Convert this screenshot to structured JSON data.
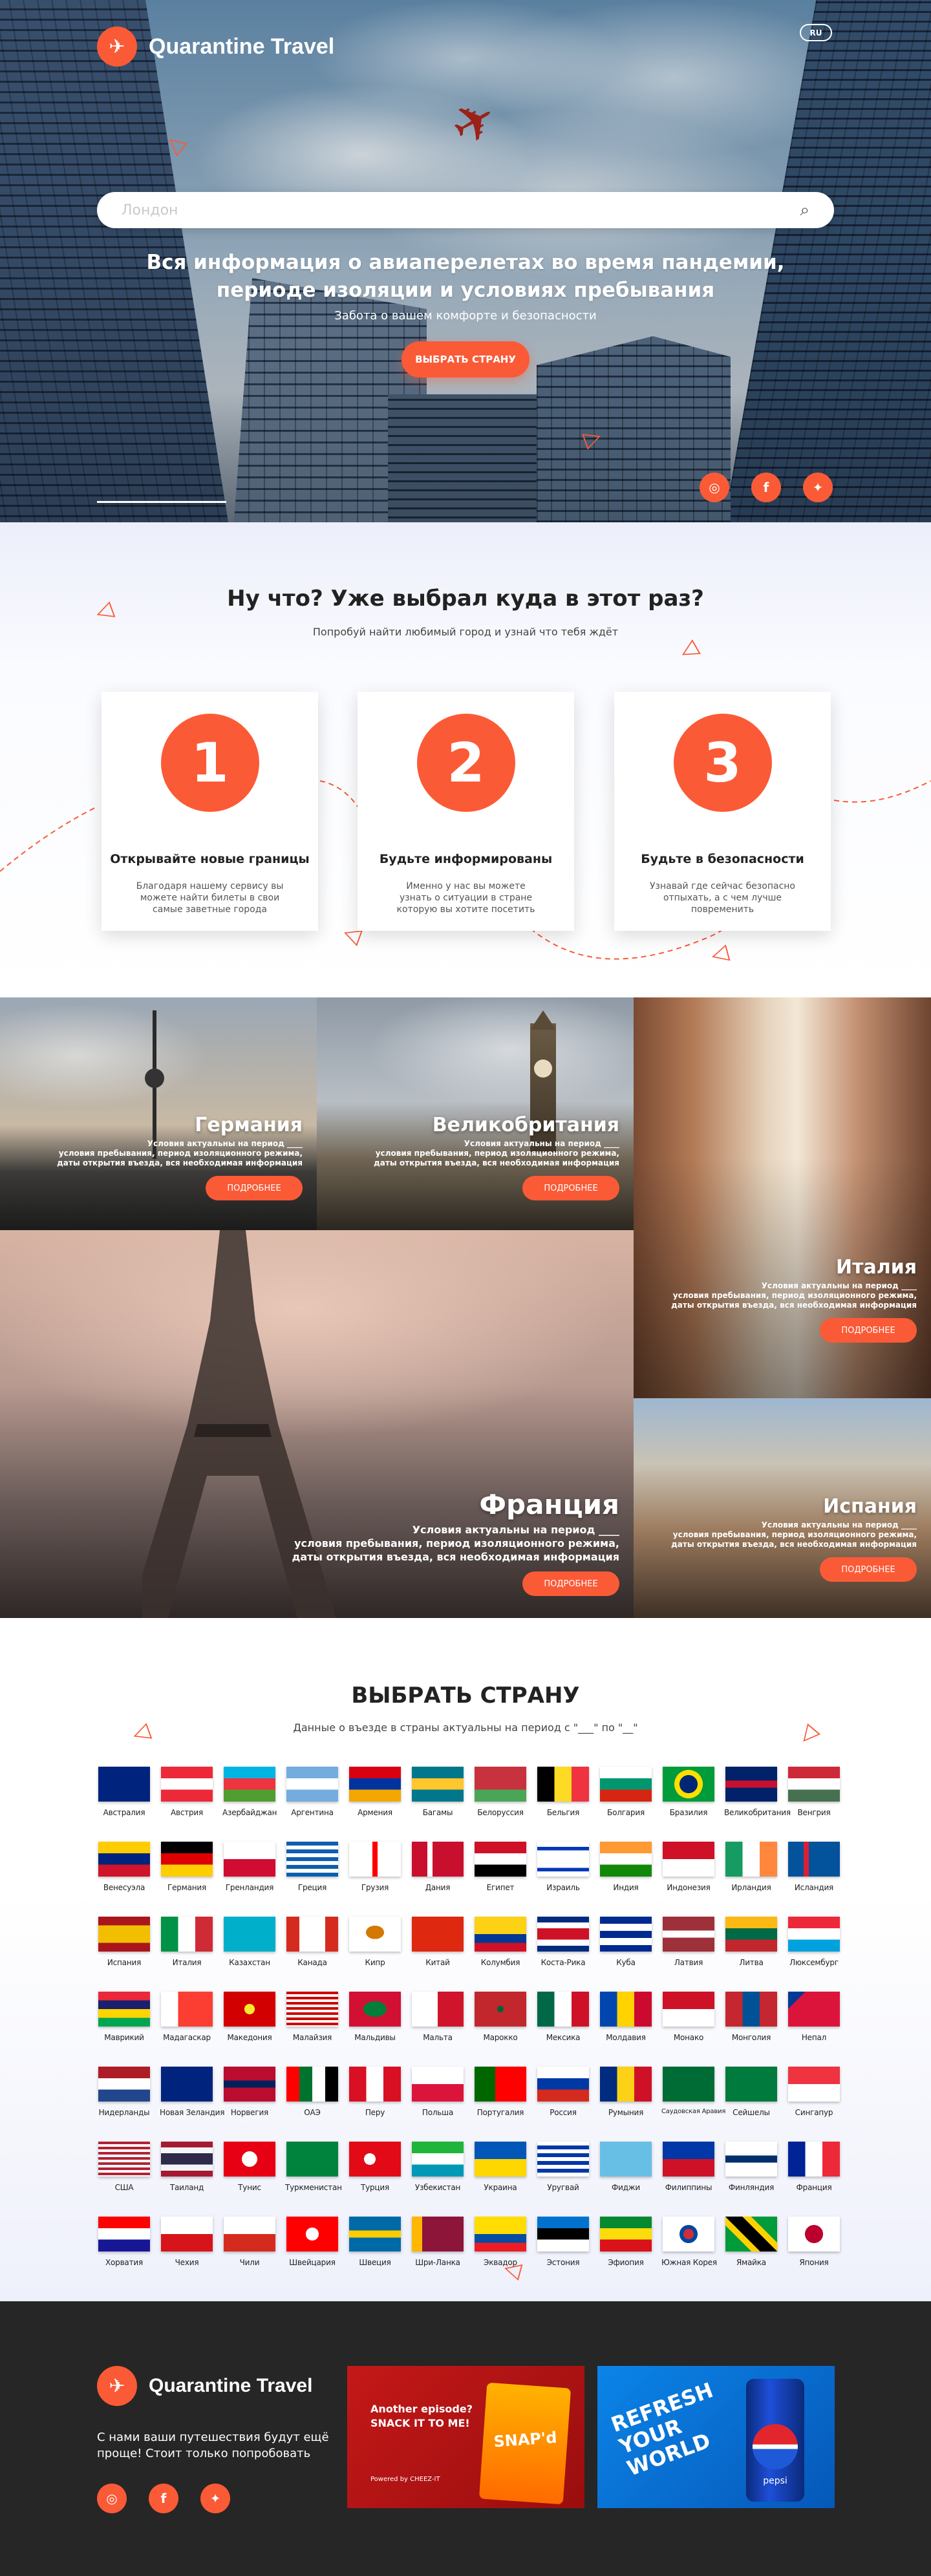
{
  "brand": {
    "name": "Quarantine Travel",
    "logo_icon": "plane-icon"
  },
  "colors": {
    "accent": "#fb5a36",
    "footer_bg": "#262626"
  },
  "hero": {
    "lang": "RU",
    "search_placeholder": "Лондон",
    "title_line1": "Вся информация о авиаперелетах во время пандемии,",
    "title_line2": "периоде изоляции и условиях пребывания",
    "subtitle": "Забота о вашем комфорте и безопасности",
    "cta": "ВЫБРАТЬ СТРАНУ"
  },
  "steps": {
    "title": "Ну что? Уже выбрал куда в этот раз?",
    "subtitle": "Попробуй найти любимый город и узнай что тебя ждёт",
    "items": [
      {
        "num": "1",
        "title": "Открывайте новые границы",
        "text": "Благодаря нашему сервису вы можете найти билеты в свои самые заветные города"
      },
      {
        "num": "2",
        "title": "Будьте информированы",
        "text": "Именно у нас вы можете узнать о ситуации в стране которую вы хотите посетить"
      },
      {
        "num": "3",
        "title": "Будьте в безопасности",
        "text": "Узнавай где сейчас безопасно отпыхать, а с чем лучше повременить"
      }
    ]
  },
  "destinations": {
    "desc_line1": "Условия актуальны  на период ____",
    "desc_line2": "условия пребывания, период изоляционного режима,",
    "desc_line3": "даты открытия въезда, вся необходимая информация",
    "button": "ПОДРОБНЕЕ",
    "items": [
      {
        "name": "Германия"
      },
      {
        "name": "Великобритания"
      },
      {
        "name": "Италия"
      },
      {
        "name": "Франция"
      },
      {
        "name": "Испания"
      }
    ]
  },
  "picker": {
    "title": "ВЫБРАТЬ СТРАНУ",
    "subtitle": "Данные о въезде в страны актуальны на период с \"___\" по \"__\"",
    "countries": [
      "Австралия",
      "Австрия",
      "Азербайджан",
      "Аргентина",
      "Армения",
      "Багамы",
      "Белоруссия",
      "Бельгия",
      "Болгария",
      "Бразилия",
      "Великобритания",
      "Венгрия",
      "Венесуэла",
      "Германия",
      "Гренландия",
      "Греция",
      "Грузия",
      "Дания",
      "Египет",
      "Израиль",
      "Индия",
      "Индонезия",
      "Ирландия",
      "Исландия",
      "Испания",
      "Италия",
      "Казахстан",
      "Канада",
      "Кипр",
      "Китай",
      "Колумбия",
      "Коста-Рика",
      "Куба",
      "Латвия",
      "Литва",
      "Люксембург",
      "Маврикий",
      "Мадагаскар",
      "Македония",
      "Малайзия",
      "Мальдивы",
      "Мальта",
      "Марокко",
      "Мексика",
      "Молдавия",
      "Монако",
      "Монголия",
      "Непал",
      "Нидерланды",
      "Новая Зеландия",
      "Норвегия",
      "ОАЭ",
      "Перу",
      "Польша",
      "Португалия",
      "Россия",
      "Румыния",
      "Саудовская Аравия",
      "Сейшелы",
      "Сингапур",
      "США",
      "Таиланд",
      "Тунис",
      "Туркменистан",
      "Турция",
      "Узбекистан",
      "Украина",
      "Уругвай",
      "Фиджи",
      "Филиппины",
      "Финляндия",
      "Франция",
      "Хорватия",
      "Чехия",
      "Чили",
      "Швейцария",
      "Швеция",
      "Шри-Ланка",
      "Эквадор",
      "Эстония",
      "Эфиопия",
      "Южная Корея",
      "Ямайка",
      "Япония"
    ]
  },
  "footer": {
    "text": "С нами ваши путешествия будут ещё проще! Стоит только попробовать",
    "ad1": {
      "line1": "Another episode?",
      "line2": "SNACK IT TO ME!",
      "product": "SNAP'd",
      "by": "Powered by CHEEZ-IT"
    },
    "ad2": {
      "line1": "REFRESH",
      "line2": "YOUR",
      "line3": "WORLD",
      "product": "pepsi"
    }
  },
  "socials": [
    "instagram-icon",
    "facebook-icon",
    "twitter-icon"
  ]
}
